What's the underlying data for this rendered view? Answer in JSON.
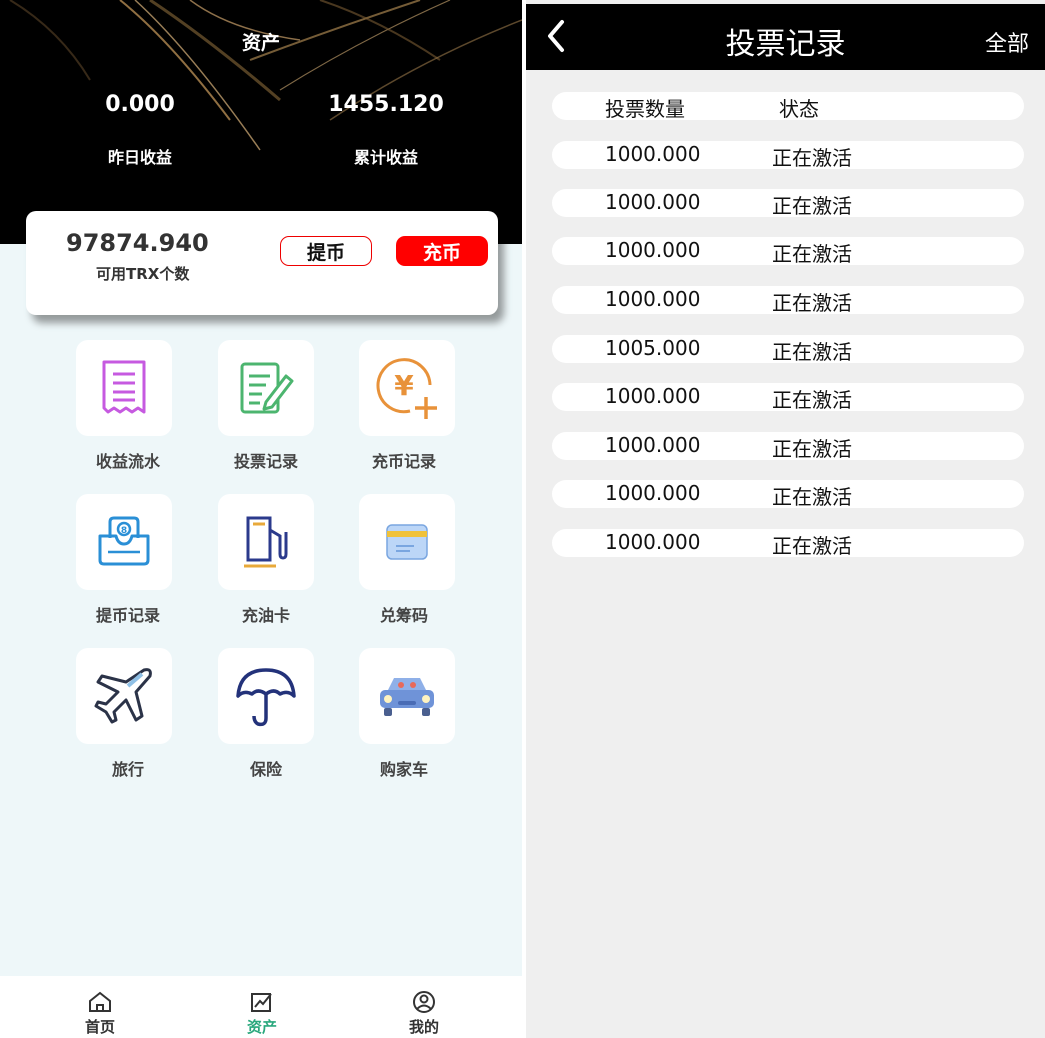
{
  "assets": {
    "title": "资产",
    "yesterday_value": "0.000",
    "yesterday_label": "昨日收益",
    "total_value": "1455.120",
    "total_label": "累计收益",
    "balance_value": "97874.940",
    "balance_label": "可用TRX个数",
    "withdraw_label": "提币",
    "deposit_label": "充币",
    "menu": [
      {
        "label": "收益流水",
        "icon": "receipt-icon"
      },
      {
        "label": "投票记录",
        "icon": "document-pen-icon"
      },
      {
        "label": "充币记录",
        "icon": "yen-plus-icon"
      },
      {
        "label": "提币记录",
        "icon": "cash-tray-icon"
      },
      {
        "label": "充油卡",
        "icon": "fuel-pump-icon"
      },
      {
        "label": "兑筹码",
        "icon": "card-icon"
      },
      {
        "label": "旅行",
        "icon": "airplane-icon"
      },
      {
        "label": "保险",
        "icon": "umbrella-icon"
      },
      {
        "label": "购家车",
        "icon": "car-icon"
      }
    ],
    "tabs": [
      {
        "label": "首页",
        "icon": "home-icon"
      },
      {
        "label": "资产",
        "icon": "chart-icon"
      },
      {
        "label": "我的",
        "icon": "user-icon"
      }
    ]
  },
  "vote_record": {
    "title": "投票记录",
    "filter_label": "全部",
    "col_amount": "投票数量",
    "col_status": "状态",
    "rows": [
      {
        "amount": "1000.000",
        "status": "正在激活"
      },
      {
        "amount": "1000.000",
        "status": "正在激活"
      },
      {
        "amount": "1000.000",
        "status": "正在激活"
      },
      {
        "amount": "1000.000",
        "status": "正在激活"
      },
      {
        "amount": "1005.000",
        "status": "正在激活"
      },
      {
        "amount": "1000.000",
        "status": "正在激活"
      },
      {
        "amount": "1000.000",
        "status": "正在激活"
      },
      {
        "amount": "1000.000",
        "status": "正在激活"
      },
      {
        "amount": "1000.000",
        "status": "正在激活"
      }
    ]
  },
  "colors": {
    "accent_red": "#ff0000",
    "active_tab": "#2aa87d",
    "header_bg": "#000000"
  }
}
